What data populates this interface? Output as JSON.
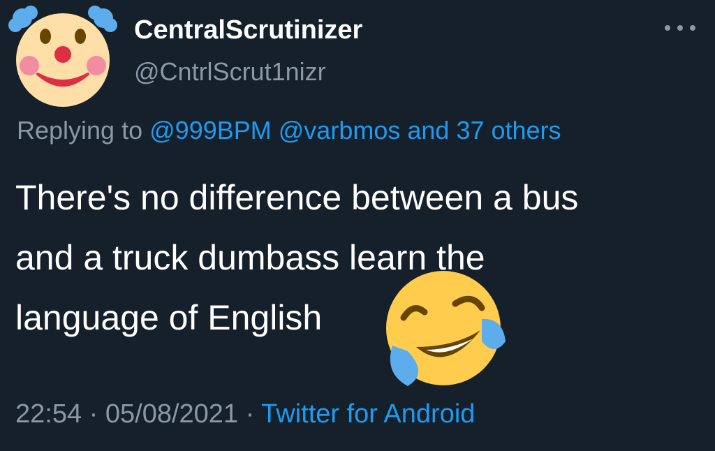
{
  "tweet": {
    "display_name": "CentralScrutinizer",
    "handle": "@CntrlScrut1nizr",
    "avatar_icon": "clown-face-icon",
    "more_icon": "more-options-icon",
    "reply_prefix": "Replying to",
    "reply_mention_1": "@999BPM",
    "reply_mention_2": "@varbmos",
    "reply_others": "and 37 others",
    "text_line_1": "There's no difference between a bus",
    "text_line_2": "and a truck dumbass learn the",
    "text_line_3": "language of English",
    "emoji_icon": "face-with-tears-of-joy-icon",
    "time": "22:54",
    "separator": "·",
    "date": "05/08/2021",
    "source": "Twitter for Android"
  },
  "colors": {
    "background": "#15202b",
    "primary_text": "#ffffff",
    "secondary_text": "#8b98a5",
    "link": "#1d9bf0"
  }
}
